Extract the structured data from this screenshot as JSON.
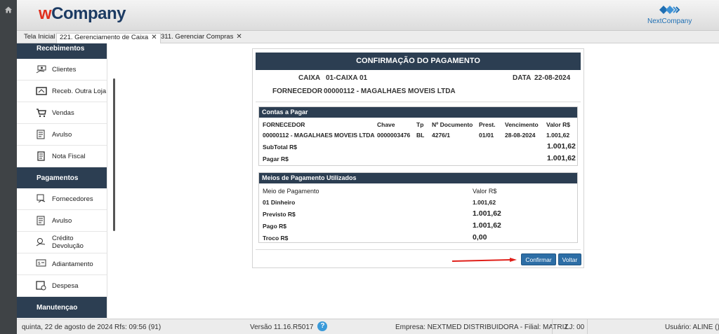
{
  "header": {
    "logo_w": "w",
    "logo_company": "Company",
    "brand_right": "NextCompany"
  },
  "tabs": [
    {
      "label": "Tela Inicial"
    },
    {
      "label": "221. Gerenciamento de Caixa",
      "close": "✕"
    },
    {
      "label": "311. Gerenciar Compras",
      "close": "✕"
    }
  ],
  "sidebar": {
    "recebimentos": "Recebimentos",
    "rec_items": [
      "Clientes",
      "Receb. Outra Loja",
      "Vendas",
      "Avulso",
      "Nota Fiscal"
    ],
    "pagamentos": "Pagamentos",
    "pag_items": [
      "Fornecedores",
      "Avulso",
      "Crédito Devolução",
      "Adiantamento",
      "Despesa"
    ],
    "manutencao": "Manutençao"
  },
  "dialog": {
    "title": "CONFIRMAÇÃO DO PAGAMENTO",
    "caixa_label": "CAIXA",
    "caixa_value": "01-CAIXA 01",
    "data_label": "DATA",
    "data_value": "22-08-2024",
    "fornecedor_label": "FORNECEDOR",
    "fornecedor_value": "00000112 - MAGALHAES MOVEIS LTDA"
  },
  "contas": {
    "title": "Contas a Pagar",
    "headers": [
      "FORNECEDOR",
      "Chave",
      "Tp",
      "Nº Documento",
      "Prest.",
      "Vencimento",
      "Valor R$"
    ],
    "row": [
      "00000112 - MAGALHAES MOVEIS LTDA",
      "0000003476",
      "BL",
      "4276/1",
      "01/01",
      "28-08-2024",
      "1.001,62"
    ],
    "subtotal_label": "SubTotal R$",
    "subtotal_value": "1.001,62",
    "pagar_label": "Pagar R$",
    "pagar_value": "1.001,62"
  },
  "meios": {
    "title": "Meios de Pagamento Utilizados",
    "col_meio": "Meio de Pagamento",
    "col_valor": "Valor R$",
    "rows": [
      {
        "label": "01 Dinheiro",
        "value": "1.001,62"
      },
      {
        "label": "Previsto R$",
        "value": "1.001,62"
      },
      {
        "label": "Pago R$",
        "value": "1.001,62"
      },
      {
        "label": "Troco R$",
        "value": "0,00"
      }
    ]
  },
  "buttons": {
    "confirmar": "Confirmar",
    "voltar": "Voltar"
  },
  "status": {
    "date": "quinta, 22 de agosto de 2024",
    "rfs": "Rfs: 09:56 (91)",
    "version": "Versão 11.16.R5017",
    "help": "?",
    "empresa": "Empresa: NEXTMED DISTRIBUIDORA - Filial: MATRIZ",
    "lj": "LJ: 00",
    "usuario": "Usuário: ALINE ()"
  },
  "colors": {
    "navy": "#2c3e52",
    "button": "#2d6ea6",
    "arrow": "#e0201a",
    "logo_red": "#e0301e"
  }
}
